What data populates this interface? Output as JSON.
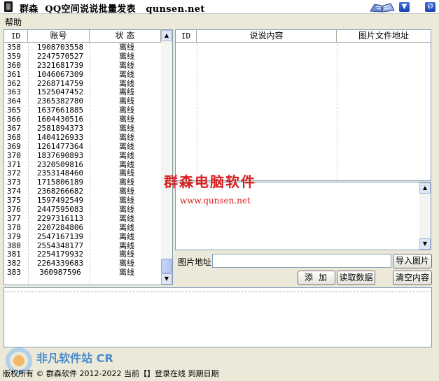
{
  "window": {
    "title": "群森  QQ空间说说批量发表   qunsen.net"
  },
  "menu": {
    "help": "帮助"
  },
  "accounts": {
    "headers": {
      "id": "ID",
      "account": "账号",
      "status": "状 态"
    },
    "rows": [
      {
        "id": "358",
        "account": "1908703558",
        "status": "离线"
      },
      {
        "id": "359",
        "account": "2247570527",
        "status": "离线"
      },
      {
        "id": "360",
        "account": "2321681739",
        "status": "离线"
      },
      {
        "id": "361",
        "account": "1046067309",
        "status": "离线"
      },
      {
        "id": "362",
        "account": "2268714759",
        "status": "离线"
      },
      {
        "id": "363",
        "account": "1525047452",
        "status": "离线"
      },
      {
        "id": "364",
        "account": "2365382780",
        "status": "离线"
      },
      {
        "id": "365",
        "account": "1637661885",
        "status": "离线"
      },
      {
        "id": "366",
        "account": "1604430516",
        "status": "离线"
      },
      {
        "id": "367",
        "account": "2581894373",
        "status": "离线"
      },
      {
        "id": "368",
        "account": "1404126933",
        "status": "离线"
      },
      {
        "id": "369",
        "account": "1261477364",
        "status": "离线"
      },
      {
        "id": "370",
        "account": "1837690893",
        "status": "离线"
      },
      {
        "id": "371",
        "account": "2320509816",
        "status": "离线"
      },
      {
        "id": "372",
        "account": "2353148460",
        "status": "离线"
      },
      {
        "id": "373",
        "account": "1715806189",
        "status": "离线"
      },
      {
        "id": "374",
        "account": "2368266682",
        "status": "离线"
      },
      {
        "id": "375",
        "account": "1597492549",
        "status": "离线"
      },
      {
        "id": "376",
        "account": "2447595083",
        "status": "离线"
      },
      {
        "id": "377",
        "account": "2297316113",
        "status": "离线"
      },
      {
        "id": "378",
        "account": "2207284806",
        "status": "离线"
      },
      {
        "id": "379",
        "account": "2547167139",
        "status": "离线"
      },
      {
        "id": "380",
        "account": "2554348177",
        "status": "离线"
      },
      {
        "id": "381",
        "account": "2254179932",
        "status": "离线"
      },
      {
        "id": "382",
        "account": "2264339683",
        "status": "离线"
      },
      {
        "id": "383",
        "account": "360987596",
        "status": "离线"
      }
    ]
  },
  "posts": {
    "headers": {
      "id": "ID",
      "content": "说说内容",
      "image_path": "图片文件地址"
    }
  },
  "watermark": {
    "company": "群森电脑软件",
    "url": "www.qunsen.net"
  },
  "form": {
    "image_label": "图片地址",
    "image_value": "",
    "import_image": "导入图片",
    "add": "添加",
    "read_data": "读取数据",
    "clear_content": "清空内容"
  },
  "footer": {
    "status": "版权所有 © 群森软件 2012-2022  当前【】登录在线   到期日期",
    "fanfan_logo": "非凡软件站 CRSKY"
  },
  "icons": {
    "app": "document-icon",
    "book": "book-icon",
    "minimize": "chevron-down-icon",
    "close": "close-icon",
    "scroll_up": "arrow-up-icon",
    "scroll_down": "arrow-down-icon"
  },
  "colors": {
    "watermark": "#d81f1f",
    "scroll_thumb": "#b5c7f2",
    "titlebar_button": "#2a55c8"
  }
}
